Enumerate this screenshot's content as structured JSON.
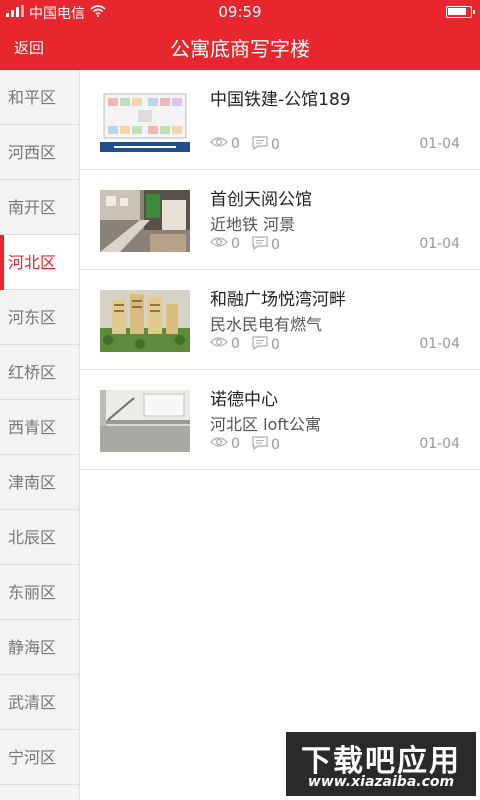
{
  "status_bar": {
    "carrier": "中国电信",
    "time": "09:59",
    "signal_icon": "signal-icon",
    "wifi_icon": "wifi-icon",
    "battery_icon": "battery-icon"
  },
  "nav": {
    "back_label": "返回",
    "title": "公寓底商写字楼"
  },
  "sidebar": {
    "items": [
      {
        "label": "和平区",
        "active": false
      },
      {
        "label": "河西区",
        "active": false
      },
      {
        "label": "南开区",
        "active": false
      },
      {
        "label": "河北区",
        "active": true
      },
      {
        "label": "河东区",
        "active": false
      },
      {
        "label": "红桥区",
        "active": false
      },
      {
        "label": "西青区",
        "active": false
      },
      {
        "label": "津南区",
        "active": false
      },
      {
        "label": "北辰区",
        "active": false
      },
      {
        "label": "东丽区",
        "active": false
      },
      {
        "label": "静海区",
        "active": false
      },
      {
        "label": "武清区",
        "active": false
      },
      {
        "label": "宁河区",
        "active": false
      }
    ]
  },
  "listings": [
    {
      "name": "中国铁建-公馆189",
      "subtitle": "",
      "views": "0",
      "comments": "0",
      "date": "01-04"
    },
    {
      "name": "首创天阅公馆",
      "subtitle": "近地铁 河景",
      "views": "0",
      "comments": "0",
      "date": "01-04"
    },
    {
      "name": "和融广场悦湾河畔",
      "subtitle": "民水民电有燃气",
      "views": "0",
      "comments": "0",
      "date": "01-04"
    },
    {
      "name": "诺德中心",
      "subtitle": "河北区 loft公寓",
      "views": "0",
      "comments": "0",
      "date": "01-04"
    }
  ],
  "icons": {
    "views": "eye-icon",
    "comments": "comment-icon"
  },
  "colors": {
    "accent": "#e8262d",
    "sidebar_bg": "#f3f3f3",
    "meta": "#999999"
  },
  "watermark": {
    "main": "下载吧应用",
    "url": "www.xiazaiba.com"
  }
}
